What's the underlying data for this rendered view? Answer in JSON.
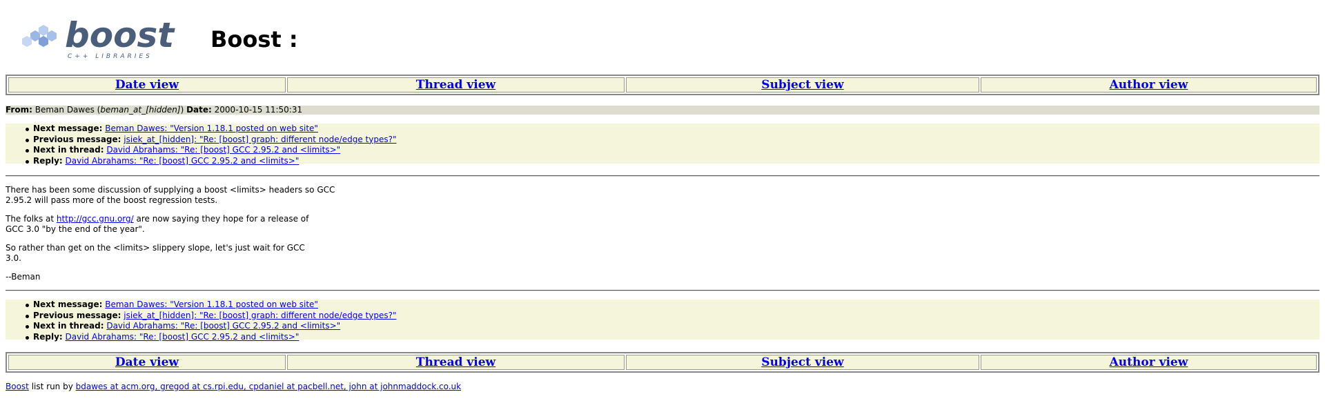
{
  "header": {
    "logo_text": "boost",
    "logo_sub": "C++ LIBRARIES",
    "title": "Boost :"
  },
  "nav": {
    "date_view": "Date view",
    "thread_view": "Thread view",
    "subject_view": "Subject view",
    "author_view": "Author view"
  },
  "message": {
    "from_label": "From:",
    "from_name": "Beman Dawes",
    "from_email": "beman_at_[hidden]",
    "date_label": "Date:",
    "date": "2000-10-15 11:50:31"
  },
  "links": {
    "next_message_label": "Next message:",
    "next_message": "Beman Dawes: \"Version 1.18.1 posted on web site\"",
    "previous_message_label": "Previous message:",
    "previous_message": "jsiek_at_[hidden]: \"Re: [boost] graph: different node/edge types?\"",
    "next_in_thread_label": "Next in thread:",
    "next_in_thread": "David Abrahams: \"Re: [boost] GCC 2.95.2 and <limits>\"",
    "reply_label": "Reply:",
    "reply": "David Abrahams: \"Re: [boost] GCC 2.95.2 and <limits>\""
  },
  "body": {
    "p1_line1": "There has been some discussion of supplying a boost <limits> headers so GCC",
    "p1_line2": "2.95.2 will pass more of the boost regression tests.",
    "p2_prefix": "The folks at ",
    "p2_link": "http://gcc.gnu.org/",
    "p2_suffix": " are now saying they hope for a release of",
    "p2_line2": "GCC 3.0 \"by the end of the year\".",
    "p3_line1": "So rather than get on the <limits> slippery slope, let's just wait for GCC",
    "p3_line2": "3.0.",
    "signature": "--Beman"
  },
  "footer": {
    "boost_link": "Boost",
    "run_by": " list run by ",
    "maintainers": "bdawes at acm.org, gregod at cs.rpi.edu, cpdaniel at pacbell.net, john at johnmaddock.co.uk"
  }
}
